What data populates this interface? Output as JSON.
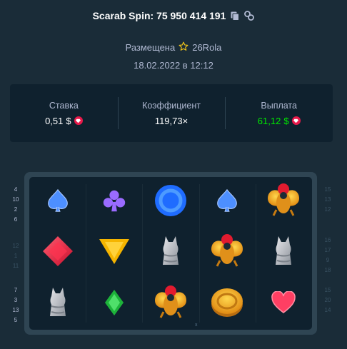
{
  "header": {
    "title": "Scarab Spin: 75 950 414 191",
    "copy_icon": "copy-icon",
    "link_icon": "link-icon"
  },
  "meta": {
    "placed_label": "Размещена",
    "user": "26Rola",
    "user_icon": "star-icon",
    "date": "18.02.2022 в 12:12"
  },
  "stats": {
    "bet_label": "Ставка",
    "bet_value": "0,51",
    "multiplier_label": "Коэффициент",
    "multiplier_value": "119,73×",
    "payout_label": "Выплата",
    "payout_value": "61,12",
    "currency": "$",
    "currency_icon": "gem-coin-icon",
    "colors": {
      "payout": "#00e701",
      "coin": "#e8194a"
    }
  },
  "reels": {
    "rows": [
      [
        "blue-spade-icon",
        "purple-club-icon",
        "blue-circle-icon",
        "blue-spade-icon",
        "scarab-icon"
      ],
      [
        "red-diamond-icon",
        "yellow-triangle-icon",
        "cat-statue-icon",
        "scarab-icon",
        "cat-statue-icon"
      ],
      [
        "cat-statue-icon",
        "green-diamond-icon",
        "scarab-icon",
        "gold-coin-icon",
        "heart-icon"
      ]
    ]
  },
  "side_numbers": {
    "left_top": [
      "4",
      "10",
      "2",
      "6"
    ],
    "left_mid": [
      "12",
      "1",
      "11"
    ],
    "left_bottom": [
      "7",
      "3",
      "13",
      "5"
    ],
    "right_top": [
      "15",
      "13",
      "12"
    ],
    "right_mid": [
      "16",
      "17",
      "9",
      "18"
    ],
    "right_bottom": [
      "15",
      "20",
      "14"
    ]
  },
  "footer_mark": "x"
}
